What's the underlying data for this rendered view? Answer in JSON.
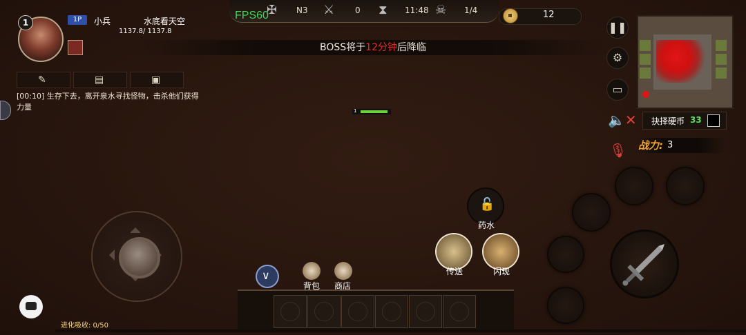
{
  "topbar": {
    "fps": "FPS60",
    "difficulty": "N3",
    "kills": "0",
    "timer": "11:48",
    "boss_count": "1/4",
    "coins": "12"
  },
  "player": {
    "level": "1",
    "badge": "1P",
    "name": "小兵",
    "guild": "水底看天空",
    "hp": "1137.8/ 1137.8"
  },
  "quest": {
    "time": "[00:10]",
    "text": "生存下去，离开泉水寻找怪物，击杀他们获得力量"
  },
  "banner": {
    "prefix": "BOSS将于",
    "highlight": "12分钟",
    "suffix": "后降临"
  },
  "enemy_bar": {
    "level": "1",
    "hp_fraction": 0.75
  },
  "right_panel": {
    "coin_select_label": "抉择硬币",
    "coin_select_count": "33",
    "power_label": "战力:",
    "power_value": "3"
  },
  "actions": {
    "potion": "药水",
    "teleport": "传送",
    "flash": "闪现",
    "bag": "背包",
    "shop": "商店"
  },
  "bottom": {
    "evolve": "进化吸收: 0/50"
  },
  "icons": [
    "pause-icon",
    "settings-icon",
    "monitor-icon",
    "mute-icon",
    "mic-off-icon",
    "lock-icon",
    "chat-icon",
    "sword-icon"
  ],
  "colors": {
    "accent_red": "#e5302a",
    "fps_green": "#3fd65a",
    "power_orange": "#f0a437",
    "hp_green": "#6cd13a"
  }
}
